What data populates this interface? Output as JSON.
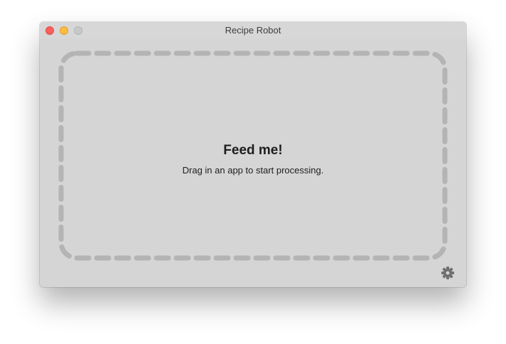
{
  "window": {
    "title": "Recipe Robot"
  },
  "drop_zone": {
    "title": "Feed me!",
    "subtitle": "Drag in an app to start processing."
  },
  "icons": {
    "settings": "gear-icon"
  },
  "colors": {
    "window_background": "#d5d5d5",
    "dash_border": "#b4b4b4",
    "close_button": "#fc605c",
    "minimize_button": "#fdbc40",
    "zoom_button": "#c8c8c8",
    "gear": "#6f6f6f"
  }
}
